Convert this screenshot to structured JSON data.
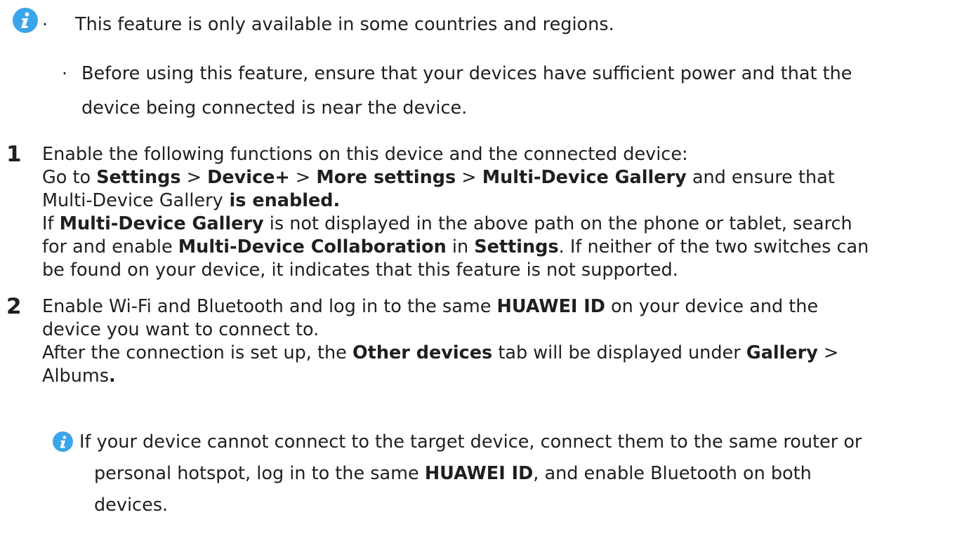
{
  "notes": {
    "items": [
      "This feature is only available in some countries and regions.",
      "Before using this feature, ensure that your devices have sufficient power and that the",
      "device being connected is near the device."
    ]
  },
  "steps": [
    {
      "number": "1",
      "lines": [
        {
          "segments": [
            "Enable the following functions on this device and the connected device:"
          ]
        },
        {
          "segments": [
            "Go to ",
            "Settings",
            " > ",
            "Device+",
            " > ",
            "More settings",
            " > ",
            "Multi-Device Gallery",
            " and ensure that"
          ]
        },
        {
          "segments": [
            "Multi-Device Gallery",
            " is enabled."
          ]
        },
        {
          "segments": [
            "If ",
            "Multi-Device Gallery",
            " is not displayed in the above path on the phone or tablet, search"
          ]
        },
        {
          "segments": [
            "for and enable ",
            "Multi-Device Collaboration",
            " in ",
            "Settings",
            ". If neither of the two switches can"
          ]
        },
        {
          "segments": [
            "be found on your device, it indicates that this feature is not supported."
          ]
        }
      ]
    },
    {
      "number": "2",
      "lines": [
        {
          "segments": [
            "Enable Wi-Fi and Bluetooth and log in to the same ",
            "HUAWEI ID",
            " on your device and the"
          ]
        },
        {
          "segments": [
            "device you want to connect to."
          ]
        },
        {
          "segments": [
            "After the connection is set up, the ",
            "Other devices",
            " tab will be displayed under ",
            "Gallery",
            " >"
          ]
        },
        {
          "segments": [
            "Albums",
            "."
          ]
        }
      ],
      "note": {
        "lines": [
          {
            "segments": [
              "If your device cannot connect to the target device, connect them to the same router or"
            ]
          },
          {
            "segments": [
              "personal hotspot, log in to the same ",
              "HUAWEI ID",
              ", and enable Bluetooth on both"
            ]
          },
          {
            "segments": [
              "devices."
            ]
          }
        ]
      }
    }
  ],
  "colors": {
    "info_icon": "#3ba4ea",
    "text": "#1f1f1f"
  },
  "icons": {
    "note": "info-icon"
  }
}
